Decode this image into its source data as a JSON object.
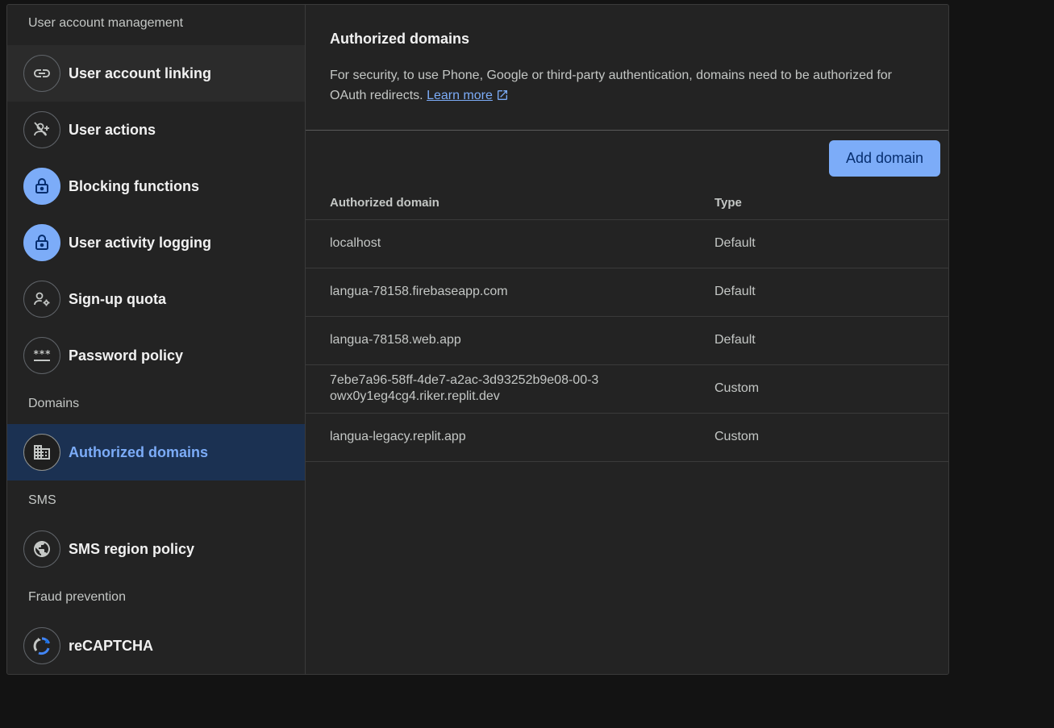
{
  "sidebar": {
    "sections": [
      {
        "header": "User account management",
        "items": [
          {
            "label": "User account linking",
            "icon": "link-icon"
          },
          {
            "label": "User actions",
            "icon": "person-off-icon"
          },
          {
            "label": "Blocking functions",
            "icon": "lock-icon"
          },
          {
            "label": "User activity logging",
            "icon": "lock-icon"
          },
          {
            "label": "Sign-up quota",
            "icon": "manage-accounts-icon"
          },
          {
            "label": "Password policy",
            "icon": "password-icon"
          }
        ]
      },
      {
        "header": "Domains",
        "items": [
          {
            "label": "Authorized domains",
            "icon": "domain-icon"
          }
        ]
      },
      {
        "header": "SMS",
        "items": [
          {
            "label": "SMS region policy",
            "icon": "globe-icon"
          }
        ]
      },
      {
        "header": "Fraud prevention",
        "items": [
          {
            "label": "reCAPTCHA",
            "icon": "recaptcha-icon"
          }
        ]
      }
    ]
  },
  "main": {
    "title": "Authorized domains",
    "description": "For security, to use Phone, Google or third-party authentication, domains need to be authorized for OAuth redirects.",
    "learn_more": "Learn more",
    "add_button": "Add domain",
    "table": {
      "columns": [
        "Authorized domain",
        "Type"
      ],
      "rows": [
        {
          "domain": "localhost",
          "type": "Default"
        },
        {
          "domain": "langua-78158.firebaseapp.com",
          "type": "Default"
        },
        {
          "domain": "langua-78158.web.app",
          "type": "Default"
        },
        {
          "domain": "7ebe7a96-58ff-4de7-a2ac-3d93252b9e08-00-3owx0y1eg4cg4.riker.replit.dev",
          "type": "Custom"
        },
        {
          "domain": "langua-legacy.replit.app",
          "type": "Custom"
        }
      ]
    }
  },
  "colors": {
    "accent": "#7cacf8",
    "active_bg": "#1b3152",
    "panel_bg": "#232323",
    "page_bg": "#131313"
  }
}
